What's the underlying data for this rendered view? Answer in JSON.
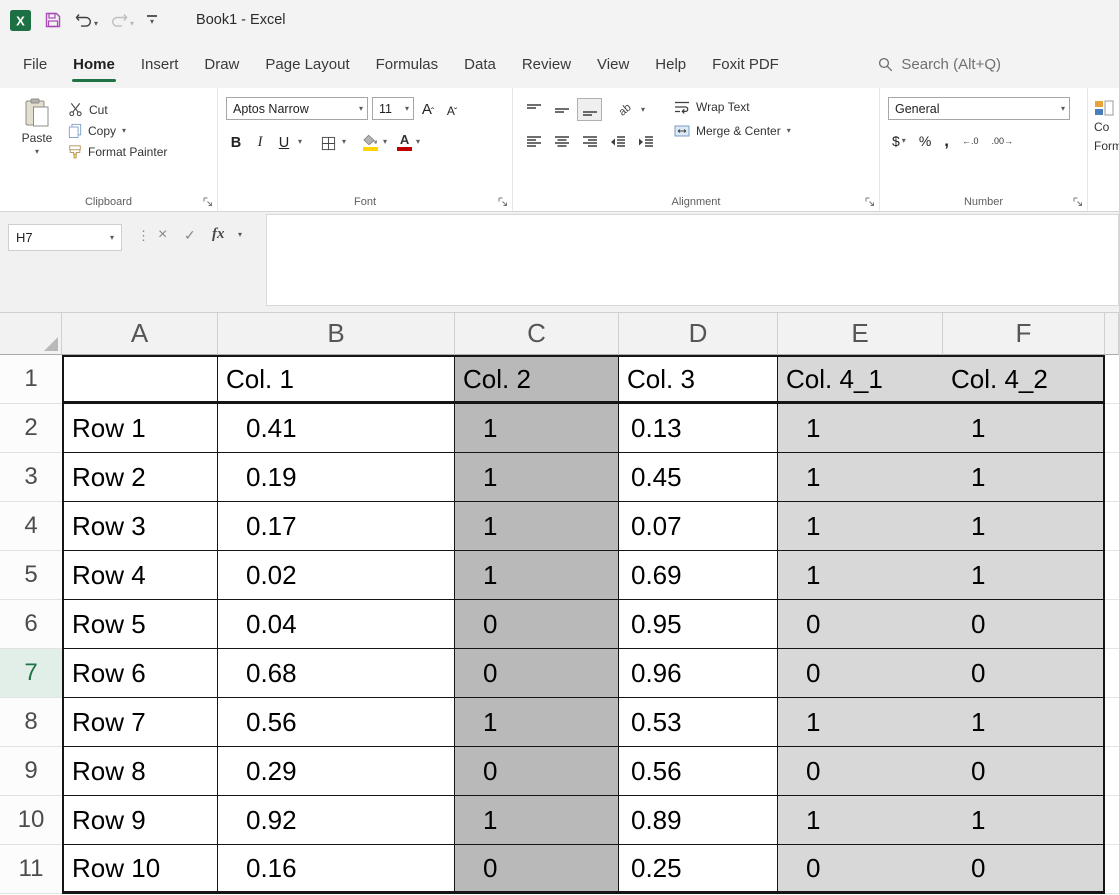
{
  "window": {
    "title": "Book1 - Excel"
  },
  "ribbon": {
    "tabs": [
      "File",
      "Home",
      "Insert",
      "Draw",
      "Page Layout",
      "Formulas",
      "Data",
      "Review",
      "View",
      "Help",
      "Foxit PDF"
    ],
    "active_tab": "Home",
    "search_placeholder": "Search (Alt+Q)",
    "groups": {
      "clipboard": {
        "label": "Clipboard",
        "paste": "Paste",
        "cut": "Cut",
        "copy": "Copy",
        "format_painter": "Format Painter"
      },
      "font": {
        "label": "Font",
        "name": "Aptos Narrow",
        "size": "11",
        "bold": "B",
        "italic": "I",
        "underline": "U",
        "grow": "A",
        "shrink": "A"
      },
      "alignment": {
        "label": "Alignment",
        "wrap_text": "Wrap Text",
        "merge_center": "Merge & Center",
        "ab": "ab"
      },
      "number": {
        "label": "Number",
        "format": "General",
        "currency": "$",
        "percent": "%",
        "comma": ",",
        "increase_decimal": "←.0",
        "decrease_decimal": ".00→"
      },
      "partial": {
        "line1": "Co",
        "line2": "Form"
      }
    }
  },
  "formula_bar": {
    "name_box": "H7",
    "cancel": "×",
    "enter": "✓",
    "fx": "fx"
  },
  "sheet": {
    "columns": [
      "A",
      "B",
      "C",
      "D",
      "E",
      "F"
    ],
    "selected_row": 7,
    "colors": {
      "accent_green": "#217346",
      "shade_dark": "#b9b9b9",
      "shade_light": "#d8d8d8",
      "font_color_bar": "#c00000"
    },
    "table": {
      "header_row": [
        "",
        "Col. 1",
        "Col. 2",
        "Col. 3",
        "Col. 4_1",
        "Col. 4_2"
      ],
      "data_rows": [
        [
          "Row 1",
          "0.41",
          "1",
          "0.13",
          "1",
          "1"
        ],
        [
          "Row 2",
          "0.19",
          "1",
          "0.45",
          "1",
          "1"
        ],
        [
          "Row 3",
          "0.17",
          "1",
          "0.07",
          "1",
          "1"
        ],
        [
          "Row 4",
          "0.02",
          "1",
          "0.69",
          "1",
          "1"
        ],
        [
          "Row 5",
          "0.04",
          "0",
          "0.95",
          "0",
          "0"
        ],
        [
          "Row 6",
          "0.68",
          "0",
          "0.96",
          "0",
          "0"
        ],
        [
          "Row 7",
          "0.56",
          "1",
          "0.53",
          "1",
          "1"
        ],
        [
          "Row 8",
          "0.29",
          "0",
          "0.56",
          "0",
          "0"
        ],
        [
          "Row 9",
          "0.92",
          "1",
          "0.89",
          "1",
          "1"
        ],
        [
          "Row 10",
          "0.16",
          "0",
          "0.25",
          "0",
          "0"
        ]
      ]
    }
  }
}
